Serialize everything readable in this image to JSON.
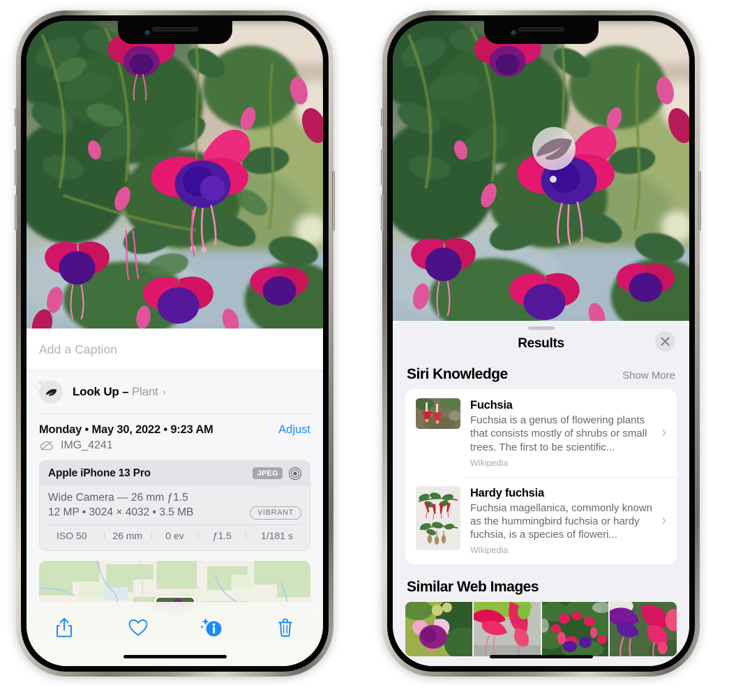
{
  "left_phone": {
    "caption": {
      "placeholder": "Add a Caption",
      "value": ""
    },
    "lookup": {
      "label": "Look Up",
      "dash": " – ",
      "kind": "Plant",
      "chevron": "›"
    },
    "meta": {
      "date": "Monday • May 30, 2022 • 9:23 AM",
      "adjust_label": "Adjust",
      "filename": "IMG_4241"
    },
    "camera_card": {
      "model": "Apple iPhone 13 Pro",
      "format_tag": "JPEG",
      "lens_line": "Wide Camera — 26 mm ƒ1.5",
      "specs_line": "12 MP • 3024 × 4032 • 3.5 MB",
      "style_tag": "VIBRANT",
      "exif": [
        "ISO 50",
        "26 mm",
        "0 ev",
        "ƒ1.5",
        "1/181 s"
      ]
    },
    "toolbar": {
      "share_label": "Share",
      "favorite_label": "Favorite",
      "info_label": "Info",
      "delete_label": "Delete"
    }
  },
  "right_phone": {
    "visual_lookup_pin": {
      "icon": "leaf-icon"
    },
    "sheet": {
      "title": "Results",
      "close_label": "Close"
    },
    "siri_knowledge": {
      "section_title": "Siri Knowledge",
      "show_more": "Show More",
      "items": [
        {
          "title": "Fuchsia",
          "description": "Fuchsia is a genus of flowering plants that consists mostly of shrubs or small trees. The first to be scientific...",
          "source": "Wikipedia",
          "chevron": "›"
        },
        {
          "title": "Hardy fuchsia",
          "description": "Fuchsia magellanica, commonly known as the hummingbird fuchsia or hardy fuchsia, is a species of floweri...",
          "source": "Wikipedia",
          "chevron": "›"
        }
      ]
    },
    "similar_web_images": {
      "section_title": "Similar Web Images",
      "thumbnails": [
        "fuchsia-magenta-white-bloom",
        "fuchsia-red-closeup",
        "fuchsia-bush-red-purple",
        "fuchsia-purple-magenta-cluster"
      ]
    }
  },
  "colors": {
    "accent_blue": "#1a8cff",
    "sheet_bg": "#f1f1f5",
    "card_bg": "#ffffff",
    "info_bg": "#f7f7f9"
  }
}
